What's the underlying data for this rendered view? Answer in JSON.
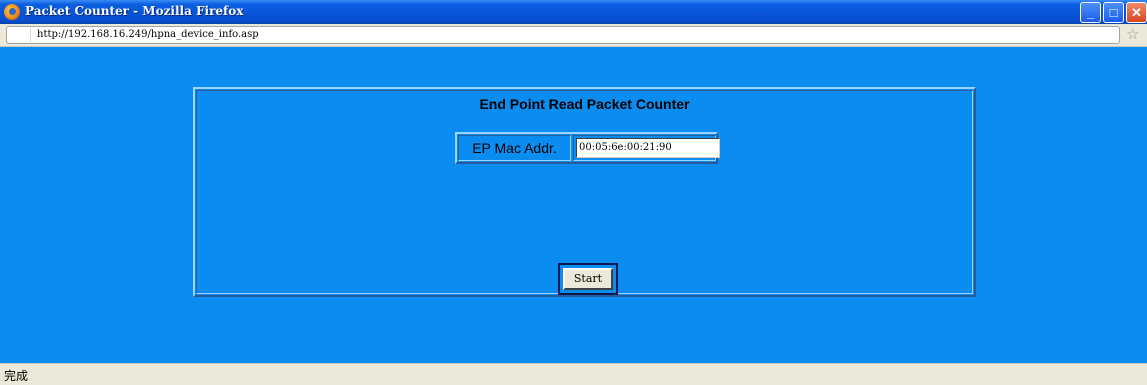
{
  "window": {
    "title": "Packet Counter - Mozilla Firefox",
    "minimize_icon": "minimize-icon",
    "maximize_icon": "maximize-icon",
    "close_icon": "close-icon",
    "minimize_glyph": "_",
    "maximize_glyph": "□",
    "close_glyph": "✕"
  },
  "addressbar": {
    "url": "http://192.168.16.249/hpna_device_info.asp",
    "bookmark_icon": "star-icon",
    "bookmark_glyph": "☆"
  },
  "page": {
    "heading": "End Point Read Packet Counter",
    "mac_label": "EP Mac Addr.",
    "mac_value": "00:05:6e:00:21:90",
    "start_label": "Start"
  },
  "statusbar": {
    "text": "完成"
  },
  "colors": {
    "page_background": "#0a8cf0",
    "titlebar": "#0852d6",
    "chrome": "#ece9d8"
  }
}
